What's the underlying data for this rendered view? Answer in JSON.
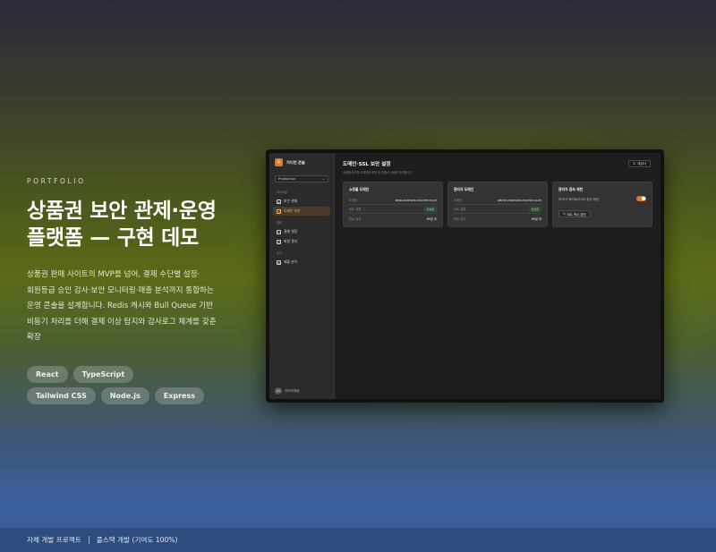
{
  "hero": {
    "eyebrow": "PORTFOLIO",
    "title_line1": "상품권 보안 관제·운영",
    "title_line2": "플랫폼 — 구현 데모",
    "desc_line1": "상품권 판매 사이트의 MVP를 넘어, 결제 수단별 설정·",
    "desc_line2": "회원등급 승인 감사·보안 모니터링·매출 분석까지 통합하는",
    "desc_line3": "운영 콘솔을 설계합니다. Redis 캐시와 Bull Queue 기반",
    "desc_line4": "비동기 처리를 더해 결제 이상 탐지와 감사로그 체계를 갖춘",
    "desc_line5": "확장",
    "tags": [
      "React",
      "TypeScript",
      "Tailwind CSS",
      "Node.js",
      "Express"
    ]
  },
  "footer": {
    "left": "자체 개발 프로젝트",
    "right": "풀스택 개발 (기여도 100%)"
  },
  "app": {
    "name": "가디언 콘솔",
    "env": "Production",
    "groups": [
      {
        "label": "모니터링",
        "items": [
          {
            "label": "보안 관제",
            "icon": "shield-icon",
            "active": false
          },
          {
            "label": "도메인 보안",
            "icon": "globe-icon",
            "active": true
          }
        ]
      },
      {
        "label": "결제",
        "items": [
          {
            "label": "결제 설정",
            "icon": "card-icon",
            "active": false
          },
          {
            "label": "회원 관리",
            "icon": "users-icon",
            "active": false
          }
        ]
      },
      {
        "label": "분석",
        "items": [
          {
            "label": "매출 분석",
            "icon": "chart-icon",
            "active": false
          }
        ]
      }
    ],
    "user": {
      "initials": "관리",
      "name": "관리자계정"
    },
    "page_title": "도메인·SSL 보안 설정",
    "page_sub": "쇼핑몰·관리자 도메인의 보안 및 인증서 상태를 관리합니다",
    "header_button": "재검사",
    "cards": [
      {
        "title": "쇼핑몰 도메인",
        "rows": [
          {
            "k": "도메인",
            "v": "shop.example-voucher.co.kr",
            "pill": false
          },
          {
            "k": "SSL 상태",
            "v": "유효함",
            "pill": true
          },
          {
            "k": "만료 일자",
            "v": "89일 후",
            "pill": false
          }
        ]
      },
      {
        "title": "관리자 도메인",
        "rows": [
          {
            "k": "도메인",
            "v": "admin.example-voucher.co.kr",
            "pill": false
          },
          {
            "k": "SSL 상태",
            "v": "유효함",
            "pill": true
          },
          {
            "k": "만료 일자",
            "v": "89일 후",
            "pill": false
          }
        ]
      }
    ],
    "options_card": {
      "title": "관리자 접속 제한",
      "toggle_label": "IP/국가 화이트리스트 접속 제한",
      "toggle_on": true,
      "button": "SSL 즉시 갱신"
    }
  }
}
